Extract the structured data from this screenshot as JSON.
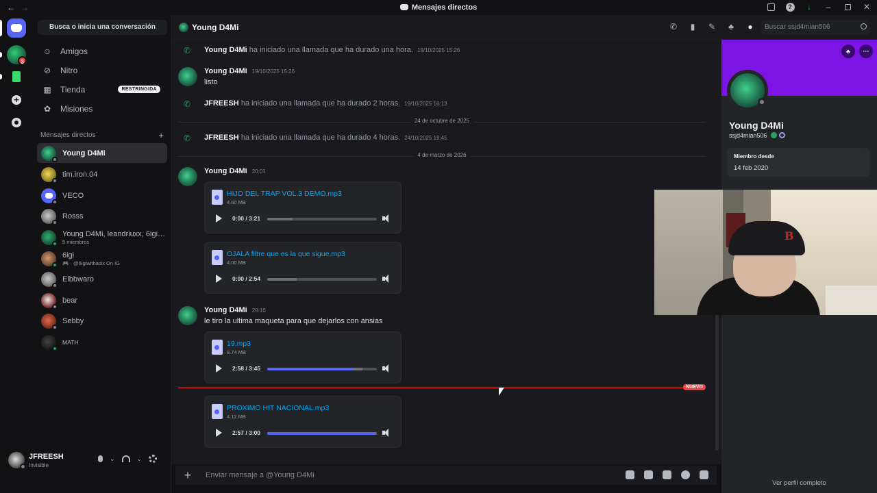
{
  "window": {
    "title": "Mensajes directos"
  },
  "sidebar": {
    "search_label": "Busca o inicia una conversación",
    "nav": [
      {
        "label": "Amigos",
        "icon": "friends-icon"
      },
      {
        "label": "Nitro",
        "icon": "nitro-icon"
      },
      {
        "label": "Tienda",
        "icon": "shop-icon",
        "badge": "RESTRINGIDA"
      },
      {
        "label": "Misiones",
        "icon": "quests-icon"
      }
    ],
    "dm_header": "Mensajes directos",
    "server_badge": "3",
    "dms": [
      {
        "name": "Young D4Mi",
        "sub": "",
        "active": true
      },
      {
        "name": "tim.iron.04",
        "sub": ""
      },
      {
        "name": "VECO",
        "sub": ""
      },
      {
        "name": "Rosss",
        "sub": ""
      },
      {
        "name": "Young D4Mi, leandriuxx, 6igi, w...",
        "sub": "5 miembros"
      },
      {
        "name": "6igi",
        "sub": "🎮 · @6igiwithasix On IG"
      },
      {
        "name": "Elbbwaro",
        "sub": ""
      },
      {
        "name": "bear",
        "sub": ""
      },
      {
        "name": "Sebby",
        "sub": ""
      },
      {
        "name": "MATH",
        "sub": ""
      }
    ]
  },
  "user": {
    "name": "JFREESH",
    "status": "Invisible"
  },
  "channel": {
    "title": "Young D4Mi",
    "search_placeholder": "Buscar ssjd4mian506"
  },
  "messages": {
    "sys1": {
      "author": "Young D4Mi",
      "text": "ha iniciado una llamada que ha durado una hora.",
      "time": "19/10/2025 15:26"
    },
    "m1": {
      "author": "Young D4Mi",
      "time": "19/10/2025 15:26",
      "text": "listo"
    },
    "sys2": {
      "author": "JFREESH",
      "text": "ha iniciado una llamada que ha durado 2 horas.",
      "time": "19/10/2025 16:13"
    },
    "div1": "24 de octubre de 2025",
    "sys3": {
      "author": "JFREESH",
      "text": "ha iniciado una llamada que ha durado 4 horas.",
      "time": "24/10/2025 19:45"
    },
    "div2": "4 de marzo de 2026",
    "m2": {
      "author": "Young D4Mi",
      "time": "20:01"
    },
    "a1": {
      "name": "HIJO DEL TRAP VOL.3 DEMO.mp3",
      "size": "4.60 MB",
      "time": "0:00 / 3:21",
      "progress": 0,
      "buffered": 0.23
    },
    "a2": {
      "name": "OJALA filtre que es la que sigue.mp3",
      "size": "4.00 MB",
      "time": "0:00 / 2:54",
      "progress": 0,
      "buffered": 0.27
    },
    "m3": {
      "author": "Young D4Mi",
      "time": "20:16",
      "text": "le tiro la ultima maqueta para que dejarlos con ansias"
    },
    "a3": {
      "name": "19.mp3",
      "size": "8.74 MB",
      "time": "2:58 / 3:45",
      "progress": 0.79,
      "buffered": 0.87
    },
    "new_label": "NUEVO",
    "a4": {
      "name": "PROXIMO HIT NACIONAL.mp3",
      "size": "4.12 MB",
      "time": "2:57 / 3:00",
      "progress": 0.98,
      "buffered": 1.0
    }
  },
  "composer": {
    "placeholder": "Enviar mensaje a @Young D4Mi"
  },
  "profile": {
    "name": "Young D4Mi",
    "username": "ssjd4mian506",
    "member_since_label": "Miembro desde",
    "member_since": "14 feb 2020",
    "full_profile": "Ver perfil completo",
    "banner_color": "#7d14e6"
  },
  "colors": {
    "accent": "#5865f2",
    "link": "#00a8fc",
    "new_line": "#f23f43",
    "call_icon": "#23a55a"
  }
}
